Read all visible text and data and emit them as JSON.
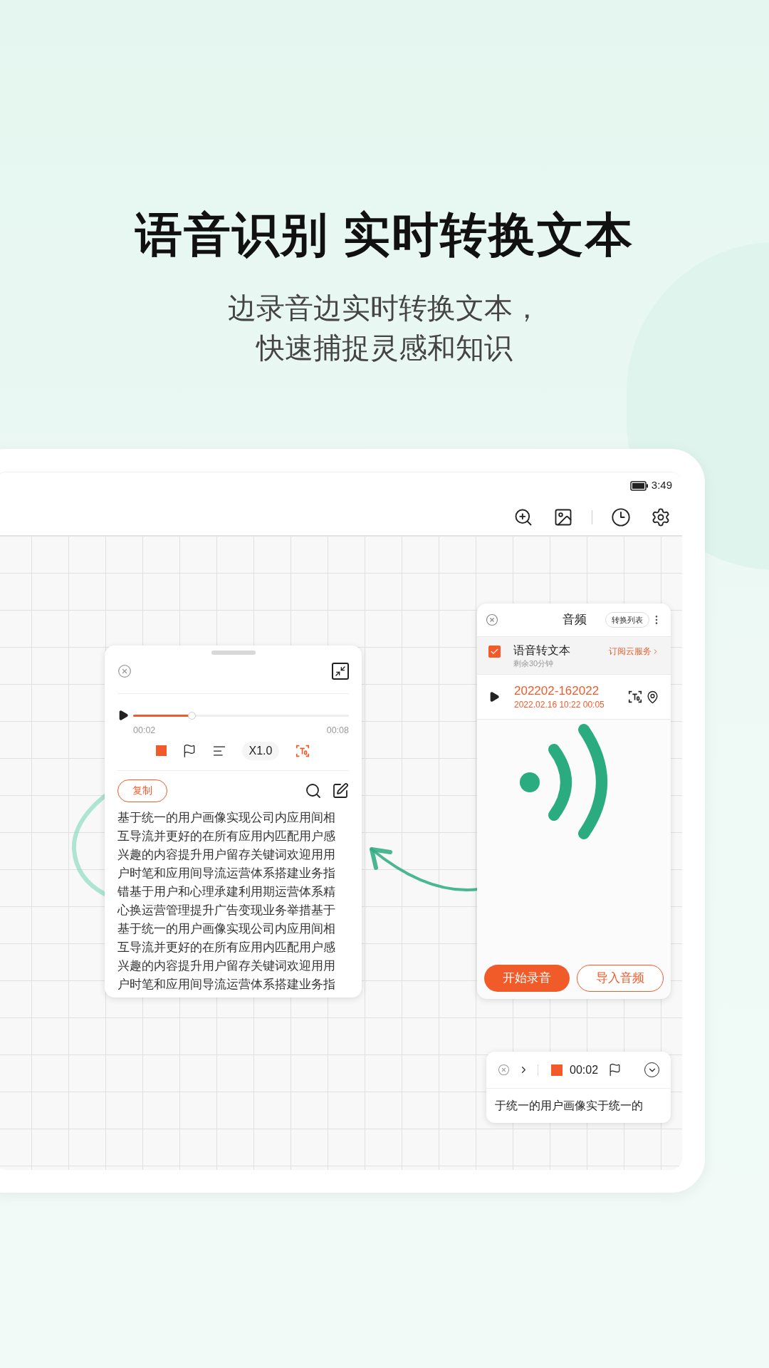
{
  "headline": "语音识别 实时转换文本",
  "subtitle_lines": [
    "边录音边实时转换文本，",
    "快速捕捉灵感和知识"
  ],
  "status_bar": {
    "time": "3:49"
  },
  "player_card": {
    "elapsed": "00:02",
    "duration": "00:08",
    "level": 0.27,
    "speed": "X1.0",
    "copy_button": "复制",
    "transcript": "基于统一的用户画像实现公司内应用间相互导流并更好的在所有应用内匹配用户感兴趣的内容提升用户留存关键词欢迎用用户时笔和应用间导流运营体系搭建业务指错基于用户和心理承建利用期运营体系精心换运营管理提升广告变现业务举措基于基于统一的用户画像实现公司内应用间相互导流并更好的在所有应用内匹配用户感兴趣的内容提升用户留存关键词欢迎用用户时笔和应用间导流运营体系搭建业务指"
  },
  "audio_panel": {
    "title": "音频",
    "list_button": "转换列表",
    "option": {
      "label": "语音转文本",
      "checked": true,
      "note": "剩余30分钟",
      "link": "订阅云服务"
    },
    "recording": {
      "name": "202202-162022",
      "meta": "2022.02.16 10:22 00:05"
    },
    "buttons": [
      {
        "label": "开始录音",
        "kind": "primary"
      },
      {
        "label": "导入音频",
        "kind": "outline"
      }
    ]
  },
  "mini_recorder": {
    "time": "00:02",
    "text": "于统一的用户画像实于统一的"
  }
}
